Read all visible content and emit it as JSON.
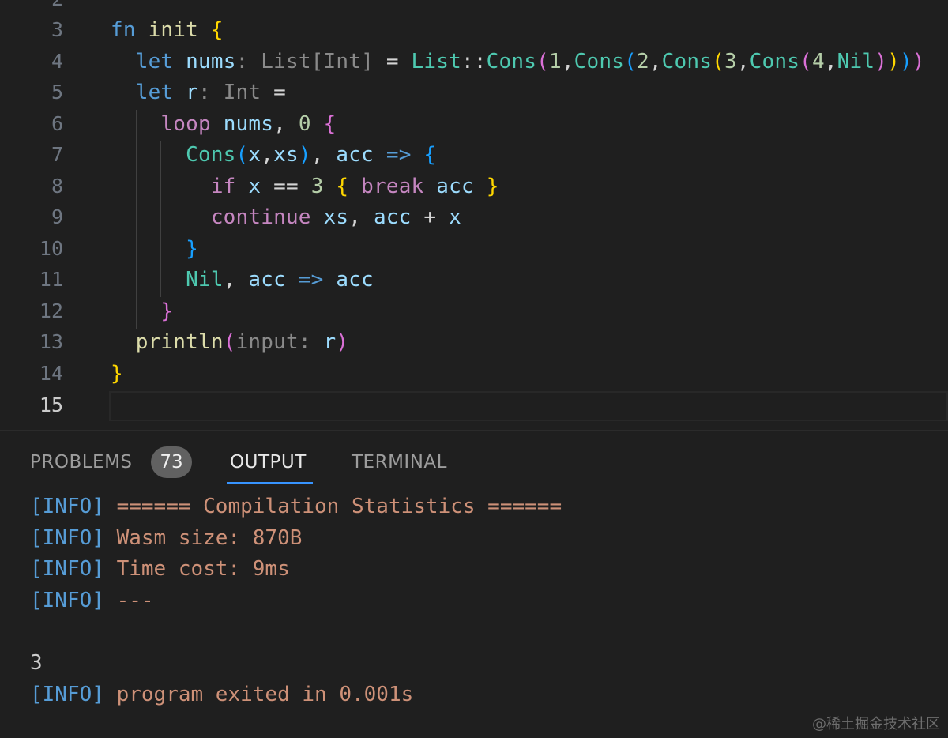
{
  "editor": {
    "line_numbers": [
      "2",
      "3",
      "4",
      "5",
      "6",
      "7",
      "8",
      "9",
      "10",
      "11",
      "12",
      "13",
      "14",
      "15"
    ],
    "active_line": "15",
    "inlay_hints": {
      "nums_type": ": List[Int]",
      "r_type": ": Int",
      "println_param": "input:"
    }
  },
  "panel": {
    "tabs": {
      "problems": "PROBLEMS",
      "problems_count": "73",
      "output": "OUTPUT",
      "terminal": "TERMINAL"
    },
    "output": {
      "tag": "[INFO]",
      "lines": [
        "====== Compilation Statistics ======",
        "Wasm size: 870B",
        "Time cost: 9ms",
        "---"
      ],
      "result": "3",
      "exit_message": "program exited in 0.001s"
    }
  },
  "watermark": "@稀土掘金技术社区",
  "colors": {
    "background": "#1f1f1f",
    "keyword": "#569cd6",
    "control": "#c586c0",
    "type": "#4ec9b0",
    "variable": "#9cdcfe",
    "number": "#b5cea8",
    "output_message": "#ce9178",
    "active_tab_underline": "#3794ff"
  }
}
